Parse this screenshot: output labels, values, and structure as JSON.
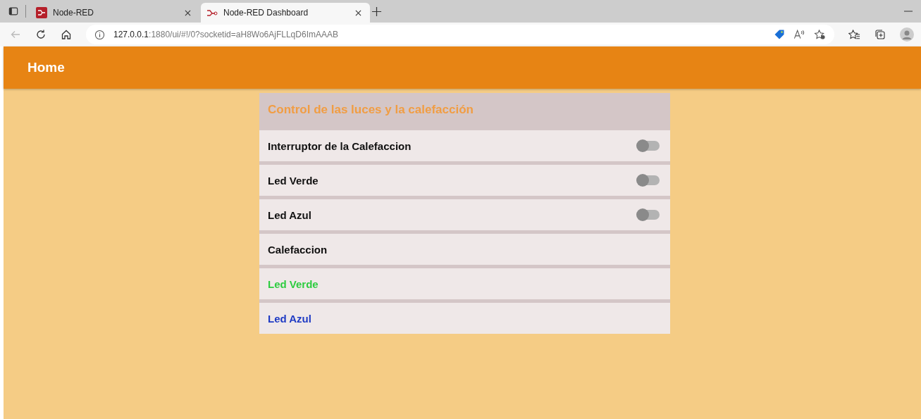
{
  "browser": {
    "tabs": [
      {
        "title": "Node-RED",
        "selected": false
      },
      {
        "title": "Node-RED Dashboard",
        "selected": true
      }
    ],
    "address": {
      "host": "127.0.0.1",
      "rest": ":1880/ui/#!/0?socketid=aH8Wo6AjFLLqD6ImAAAB"
    }
  },
  "header": {
    "title": "Home"
  },
  "group": {
    "title": "Control de las luces y la calefacción",
    "rows": [
      {
        "kind": "switch",
        "label": "Interruptor de la Calefaccion",
        "on": false
      },
      {
        "kind": "switch",
        "label": "Led Verde",
        "on": false
      },
      {
        "kind": "switch",
        "label": "Led Azul",
        "on": false
      },
      {
        "kind": "text",
        "label": "Calefaccion",
        "color": "#111111"
      },
      {
        "kind": "text",
        "label": "Led Verde",
        "color": "#2ecc40"
      },
      {
        "kind": "text",
        "label": "Led Azul",
        "color": "#1f3bc4"
      }
    ]
  }
}
